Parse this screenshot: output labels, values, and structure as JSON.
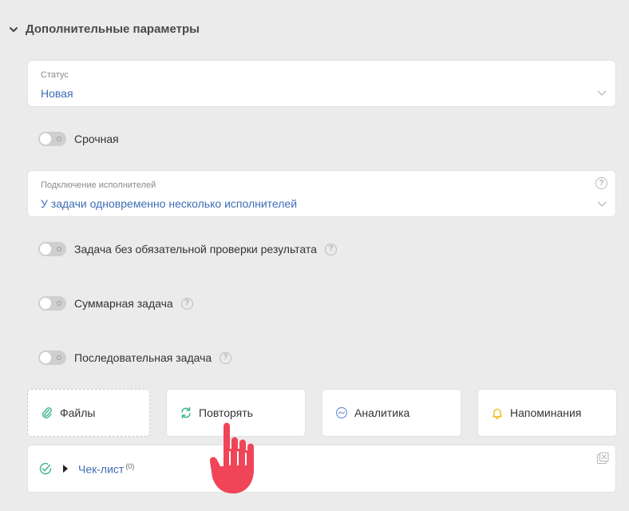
{
  "section": {
    "title": "Дополнительные параметры"
  },
  "status": {
    "label": "Статус",
    "value": "Новая"
  },
  "urgent": {
    "label": "Срочная"
  },
  "assignees": {
    "label": "Подключение исполнителей",
    "value": "У задачи одновременно несколько исполнителей"
  },
  "no_review": {
    "label": "Задача без обязательной проверки результата"
  },
  "summary": {
    "label": "Суммарная задача"
  },
  "sequential": {
    "label": "Последовательная задача"
  },
  "help_glyph": "?",
  "tiles": {
    "files": "Файлы",
    "repeat": "Повторять",
    "analytics": "Аналитика",
    "reminders": "Напоминания"
  },
  "checklist": {
    "label": "Чек-лист",
    "count": "(0)"
  },
  "colors": {
    "accent_blue": "#3e6db5",
    "green": "#3fb58a",
    "yellow": "#e8b80c",
    "hand_red": "#f04558"
  },
  "icons": {
    "section_toggle": "chevron-down-icon",
    "files": "paperclip-icon",
    "repeat": "repeat-icon",
    "analytics": "analytics-icon",
    "reminders": "bell-icon",
    "checklist": "check-circle-icon",
    "checklist_corner": "expand-icon",
    "cursor": "hand-pointer-icon"
  }
}
